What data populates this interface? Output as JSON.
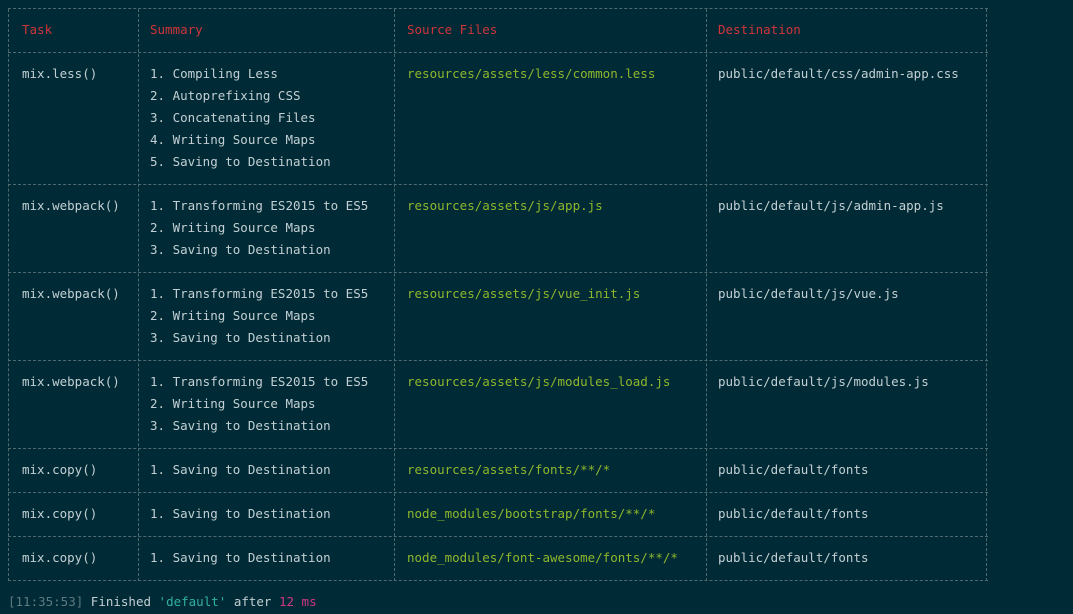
{
  "table": {
    "headers": {
      "task": "Task",
      "summary": "Summary",
      "source": "Source Files",
      "destination": "Destination"
    },
    "rows": [
      {
        "task": "mix.less()",
        "summary": [
          "1. Compiling Less",
          "2. Autoprefixing CSS",
          "3. Concatenating Files",
          "4. Writing Source Maps",
          "5. Saving to Destination"
        ],
        "source": "resources/assets/less/common.less",
        "destination": "public/default/css/admin-app.css"
      },
      {
        "task": "mix.webpack()",
        "summary": [
          "1. Transforming ES2015 to ES5",
          "2. Writing Source Maps",
          "3. Saving to Destination"
        ],
        "source": "resources/assets/js/app.js",
        "destination": "public/default/js/admin-app.js"
      },
      {
        "task": "mix.webpack()",
        "summary": [
          "1. Transforming ES2015 to ES5",
          "2. Writing Source Maps",
          "3. Saving to Destination"
        ],
        "source": "resources/assets/js/vue_init.js",
        "destination": "public/default/js/vue.js"
      },
      {
        "task": "mix.webpack()",
        "summary": [
          "1. Transforming ES2015 to ES5",
          "2. Writing Source Maps",
          "3. Saving to Destination"
        ],
        "source": "resources/assets/js/modules_load.js",
        "destination": "public/default/js/modules.js"
      },
      {
        "task": "mix.copy()",
        "summary": [
          "1. Saving to Destination"
        ],
        "source": "resources/assets/fonts/**/*",
        "destination": "public/default/fonts"
      },
      {
        "task": "mix.copy()",
        "summary": [
          "1. Saving to Destination"
        ],
        "source": "node_modules/bootstrap/fonts/**/*",
        "destination": "public/default/fonts"
      },
      {
        "task": "mix.copy()",
        "summary": [
          "1. Saving to Destination"
        ],
        "source": "node_modules/font-awesome/fonts/**/*",
        "destination": "public/default/fonts"
      }
    ]
  },
  "status": {
    "timestamp": "[11:35:53]",
    "finished_text": "Finished",
    "task_name": "'default'",
    "after_text": "after",
    "duration": "12 ms"
  },
  "colors": {
    "background": "#002b36",
    "header_text": "#d0343a",
    "source_path": "#8fb62c",
    "task_name": "#2fb0a3",
    "duration": "#d33682"
  }
}
